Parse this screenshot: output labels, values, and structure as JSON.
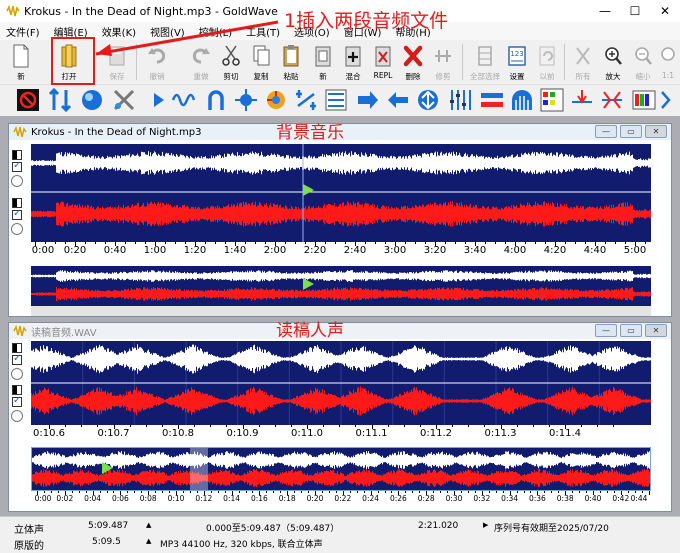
{
  "window": {
    "title": "Krokus - In the Dead of Night.mp3 - GoldWave",
    "minimize": "—",
    "maximize": "☐",
    "close": "✕"
  },
  "menu": [
    "文件(F)",
    "编辑(E)",
    "效果(K)",
    "视图(V)",
    "控制(L)",
    "工具(T)",
    "选项(O)",
    "窗口(W)",
    "帮助(H)"
  ],
  "toolbar": {
    "buttons": [
      {
        "id": "new",
        "label": "新",
        "icon": "new-file-icon",
        "enabled": true
      },
      {
        "id": "open",
        "label": "打开",
        "icon": "open-folder-icon",
        "enabled": true
      },
      {
        "id": "save",
        "label": "保存",
        "icon": "save-icon",
        "enabled": false
      },
      {
        "id": "undo",
        "label": "撤销",
        "icon": "undo-icon",
        "enabled": false
      },
      {
        "id": "redo",
        "label": "重做",
        "icon": "redo-icon",
        "enabled": false
      },
      {
        "id": "cut",
        "label": "剪切",
        "icon": "scissors-icon",
        "enabled": true
      },
      {
        "id": "copy",
        "label": "复制",
        "icon": "copy-icon",
        "enabled": true
      },
      {
        "id": "paste",
        "label": "粘贴",
        "icon": "paste-icon",
        "enabled": true
      },
      {
        "id": "pastenew",
        "label": "新",
        "icon": "paste-new-icon",
        "enabled": true
      },
      {
        "id": "mix",
        "label": "混合",
        "icon": "mix-icon",
        "enabled": true
      },
      {
        "id": "repl",
        "label": "REPL",
        "icon": "replace-icon",
        "enabled": true
      },
      {
        "id": "delete",
        "label": "删除",
        "icon": "delete-icon",
        "enabled": true
      },
      {
        "id": "trim",
        "label": "修剪",
        "icon": "trim-icon",
        "enabled": false
      },
      {
        "id": "selectall",
        "label": "全部选择",
        "icon": "select-all-icon",
        "enabled": false
      },
      {
        "id": "set",
        "label": "设置",
        "icon": "set-marker-icon",
        "enabled": true
      },
      {
        "id": "previous",
        "label": "以前",
        "icon": "previous-icon",
        "enabled": false
      },
      {
        "id": "all",
        "label": "所有",
        "icon": "zoom-all-icon",
        "enabled": false
      },
      {
        "id": "zoomin",
        "label": "放大",
        "icon": "zoom-in-icon",
        "enabled": true
      },
      {
        "id": "zoomout",
        "label": "缩小",
        "icon": "zoom-out-icon",
        "enabled": false
      },
      {
        "id": "zoom11",
        "label": "1:1",
        "icon": "zoom-1-1-icon",
        "enabled": false
      }
    ]
  },
  "documents": [
    {
      "title": "Krokus - In the Dead of Night.mp3",
      "ruler": [
        "0:00",
        "0:20",
        "0:40",
        "1:00",
        "1:20",
        "1:40",
        "2:00",
        "2:20",
        "2:40",
        "3:00",
        "3:20",
        "3:40",
        "4:00",
        "4:20",
        "4:40",
        "5:00"
      ],
      "channel_labels": [
        "0",
        "0"
      ]
    },
    {
      "title": "读稿音频.WAV",
      "ruler": [
        "0:10.6",
        "0:10.7",
        "0:10.8",
        "0:10.9",
        "0:11.0",
        "0:11.1",
        "0:11.2",
        "0:11.3",
        "0:11.4"
      ],
      "mini_ruler": [
        "0:00",
        "0:02",
        "0:04",
        "0:06",
        "0:08",
        "0:10",
        "0:12",
        "0:14",
        "0:16",
        "0:18",
        "0:20",
        "0:22",
        "0:24",
        "0:26",
        "0:28",
        "0:30",
        "0:32",
        "0:34",
        "0:36",
        "0:38",
        "0:40",
        "0:42",
        "0:44"
      ],
      "channel_labels": [
        "0",
        "0"
      ]
    }
  ],
  "status": {
    "row1": {
      "mode": "立体声",
      "length": "5:09.487",
      "selection": "0.000至5:09.487（5:09.487）",
      "position": "2:21.020",
      "notice": "序列号有效期至2025/07/20"
    },
    "row2": {
      "label": "原版的",
      "duration": "5:09.5",
      "format": "MP3 44100 Hz, 320 kbps, 联合立体声"
    }
  },
  "annotations": {
    "step1": "1插入两段音频文件",
    "bg_music": "背景音乐",
    "voice": "读稿人声"
  },
  "colors": {
    "wave_bg": "#111c6e",
    "wave_white": "#ffffff",
    "wave_red": "#ff1a1a",
    "annotation": "#e21b1b",
    "play_marker": "#7be04a"
  }
}
